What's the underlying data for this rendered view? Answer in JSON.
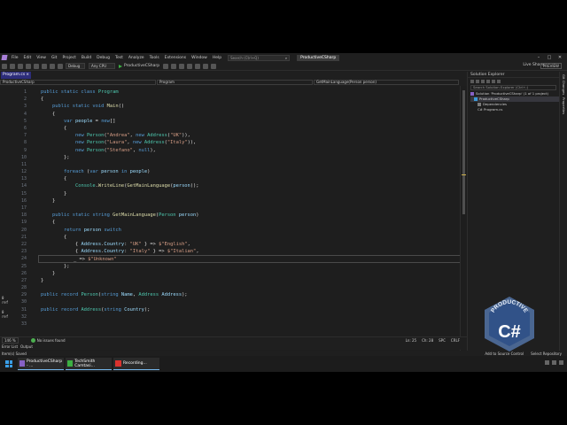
{
  "menubar": {
    "items": [
      "File",
      "Edit",
      "View",
      "Git",
      "Project",
      "Build",
      "Debug",
      "Test",
      "Analyze",
      "Tools",
      "Extensions",
      "Window",
      "Help"
    ],
    "search_placeholder": "Search (Ctrl+Q)",
    "solution_name": "ProductiveCSharp"
  },
  "toolbar": {
    "config": "Debug",
    "platform": "Any CPU",
    "run_label": "ProductiveCSharp",
    "live_share": "Live Share",
    "preview": "PREVIEW"
  },
  "editor": {
    "tab_label": "Program.cs",
    "nav_project": "ProductiveCSharp",
    "nav_class": "Program",
    "nav_member": "GetMainLanguage(Person person)",
    "line_numbers": [
      "1",
      "2",
      "3",
      "4",
      "5",
      "6",
      "7",
      "8",
      "9",
      "10",
      "11",
      "12",
      "13",
      "14",
      "15",
      "16",
      "17",
      "18",
      "19",
      "20",
      "21",
      "22",
      "23",
      "24",
      "25",
      "26",
      "27",
      "28",
      "29",
      "30",
      "31",
      "32",
      "33"
    ],
    "ref_marks": {
      "line30": "0 ref",
      "line32": "0 ref"
    },
    "zoom": "146 %",
    "issues": "No issues found",
    "position": {
      "ln": "Ln: 25",
      "ch": "Ch: 28",
      "spc": "SPC",
      "crlf": "CRLF"
    }
  },
  "code": {
    "l1_kw": "public static class ",
    "l1_ty": "Program",
    "l2": "{",
    "l3_kw": "    public static void ",
    "l3_fn": "Main",
    "l3_rest": "()",
    "l4": "    {",
    "l5_kw": "        var ",
    "l5_pr": "people",
    "l5_rest": " = ",
    "l5_kw2": "new",
    "l5_end": "[]",
    "l6": "        {",
    "l7_a": "            ",
    "l7_kw": "new ",
    "l7_ty": "Person",
    "l7_s1": "\"Andrea\"",
    "l7_m": ", ",
    "l7_kw2": "new ",
    "l7_ty2": "Address",
    "l7_s2": "\"UK\"",
    "l7_end": ")),",
    "l8_s1": "\"Laura\"",
    "l8_s2": "\"Italy\"",
    "l9_s1": "\"Stefano\"",
    "l9_null": "null",
    "l9_end": "),",
    "l10": "        };",
    "l12_kw": "        foreach ",
    "l12_kw2": "var ",
    "l12_pr": "person ",
    "l12_kw3": "in ",
    "l12_pr2": "people",
    "l13": "        {",
    "l14_ty": "Console",
    "l14_fn": "WriteLine",
    "l14_fn2": "GetMainLanguage",
    "l14_pr": "person",
    "l15": "        }",
    "l16": "    }",
    "l18_kw": "    public static string ",
    "l18_fn": "GetMainLanguage",
    "l18_ty": "Person ",
    "l18_pr": "person",
    "l19": "    {",
    "l20_kw": "        return ",
    "l20_pr": "person ",
    "l20_kw2": "switch",
    "l21": "        {",
    "l22_pr": "Address",
    "l22_pr2": "Country",
    "l22_s": "\"UK\"",
    "l22_s2": "$\"English\"",
    "l23_s": "\"Italy\"",
    "l23_s2": "$\"Italian\"",
    "l24_s": "$\"Unknown\"",
    "l25": "        };",
    "l26": "    }",
    "l27": "}",
    "l29_kw": "public record ",
    "l29_ty": "Person",
    "l29_kw2": "string ",
    "l29_pr": "Name",
    "l29_ty2": "Address ",
    "l29_pr2": "Address",
    "l31_ty": "Address",
    "l31_pr": "Country"
  },
  "solution_explorer": {
    "title": "Solution Explorer",
    "search_placeholder": "Search Solution Explorer (Ctrl+;)",
    "items": [
      "Solution 'ProductiveCSharp' (1 of 1 project)",
      "ProductiveCSharp",
      "Dependencies",
      "C# Program.cs"
    ]
  },
  "right_strip": {
    "tab1": "Git Changes",
    "tab2": "Properties"
  },
  "bottom_tabs": [
    "Error List",
    "Output"
  ],
  "statusbar": {
    "left": "Item(s) Saved",
    "add_source": "Add to Source Control",
    "select_repo": "Select Repository"
  },
  "taskbar": {
    "items": [
      "ProductiveCSharp - ...",
      "TechSmith Camtasi...",
      "Recording..."
    ]
  },
  "logo": {
    "text": "PRODUCTIVE",
    "glyph": "C#"
  },
  "colors": {
    "accent": "#68217a",
    "keyword": "#569cd6",
    "type": "#4ec9b0",
    "string": "#d69d85",
    "method": "#dcdcaa"
  }
}
